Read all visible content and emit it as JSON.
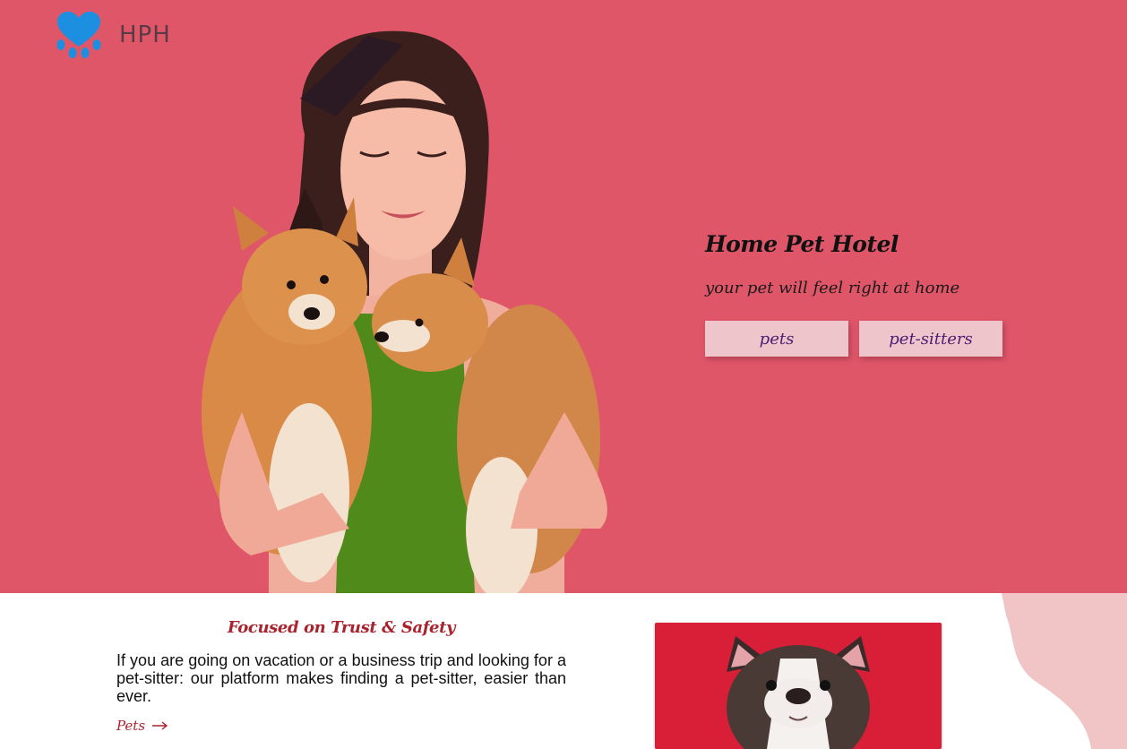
{
  "brand": {
    "name": "HPH",
    "logo_icon": "paw-heart-icon",
    "logo_color": "#1d8fe0"
  },
  "hero": {
    "background": "#e05669",
    "title": "Home Pet Hotel",
    "subtitle": "your pet will feel right at home",
    "buttons": [
      {
        "label": "pets"
      },
      {
        "label": "pet-sitters"
      }
    ]
  },
  "feature": {
    "title": "Focused on Trust & Safety",
    "text": "If you are going on vacation or a business trip and looking for a pet-sitter: our platform makes finding a pet-sitter, easier than ever.",
    "link_label": "Pets",
    "link_icon": "arrow-right-icon",
    "accent": "#a8232e"
  },
  "card": {
    "background": "#d81f37"
  }
}
